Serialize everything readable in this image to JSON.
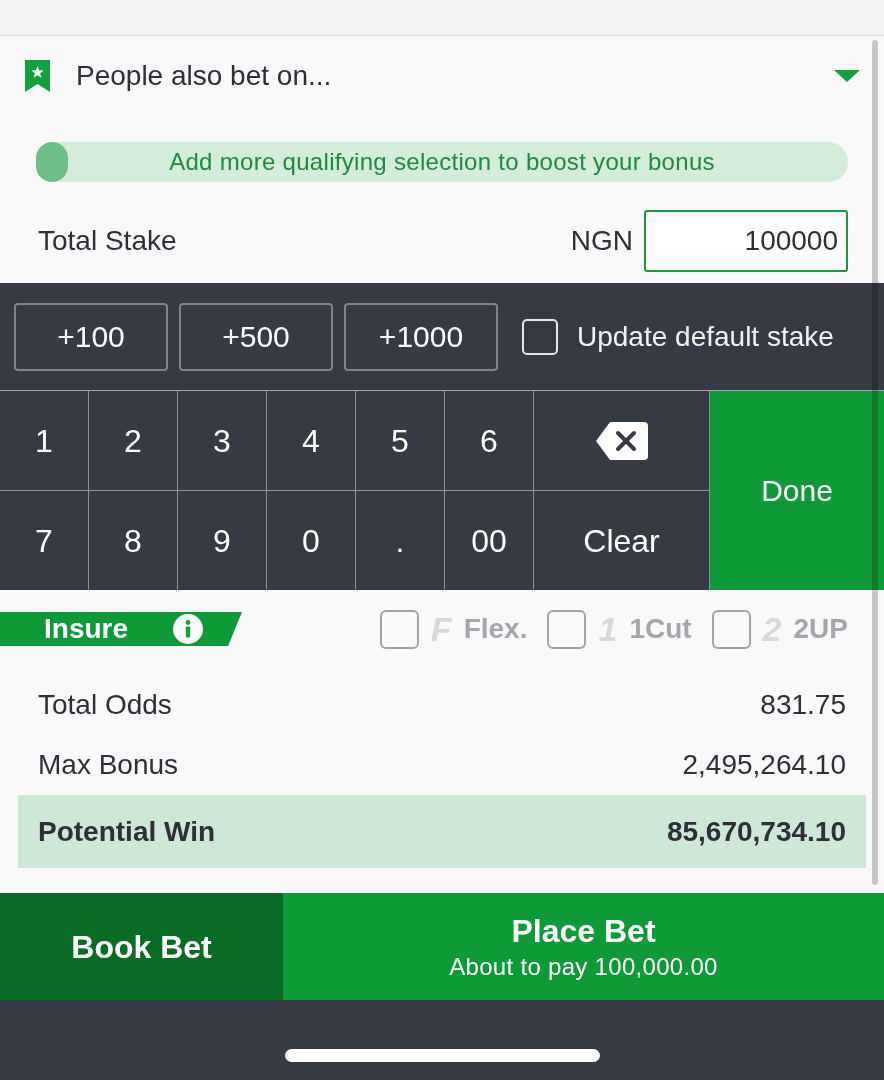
{
  "section": {
    "title": "People also bet on...",
    "expanded": false
  },
  "bonus_progress": {
    "message": "Add more qualifying selection to boost your bonus",
    "level": 0.04
  },
  "stake": {
    "label": "Total Stake",
    "currency": "NGN",
    "value": "100000"
  },
  "quick_stakes": [
    "+100",
    "+500",
    "+1000"
  ],
  "default_stake": {
    "label": "Update default stake",
    "checked": false
  },
  "keypad": {
    "rows": [
      [
        {
          "kind": "key",
          "label": "1"
        },
        {
          "kind": "key",
          "label": "2"
        },
        {
          "kind": "key",
          "label": "3"
        },
        {
          "kind": "key",
          "label": "4"
        },
        {
          "kind": "key",
          "label": "5"
        },
        {
          "kind": "key",
          "label": "6"
        },
        {
          "kind": "backspace"
        }
      ],
      [
        {
          "kind": "key",
          "label": "7"
        },
        {
          "kind": "key",
          "label": "8"
        },
        {
          "kind": "key",
          "label": "9"
        },
        {
          "kind": "key",
          "label": "0"
        },
        {
          "kind": "key",
          "label": "."
        },
        {
          "kind": "key",
          "label": "00"
        },
        {
          "kind": "key",
          "label": "Clear"
        }
      ]
    ],
    "done": "Done"
  },
  "insure": {
    "label": "Insure",
    "options": [
      {
        "logo": "F",
        "label": "Flex.",
        "checked": false
      },
      {
        "logo": "1",
        "label": "1Cut",
        "checked": false
      },
      {
        "logo": "2",
        "label": "2UP",
        "checked": false
      }
    ]
  },
  "summary": [
    {
      "label": "Total Odds",
      "value": "831.75",
      "highlighted": false
    },
    {
      "label": "Max Bonus",
      "value": "2,495,264.10",
      "highlighted": false
    },
    {
      "label": "Potential Win",
      "value": "85,670,734.10",
      "highlighted": true
    }
  ],
  "actions": [
    {
      "kind": "secondary",
      "label": "Book Bet"
    },
    {
      "kind": "primary",
      "label": "Place Bet",
      "sublabel": "About to pay 100,000.00"
    }
  ]
}
